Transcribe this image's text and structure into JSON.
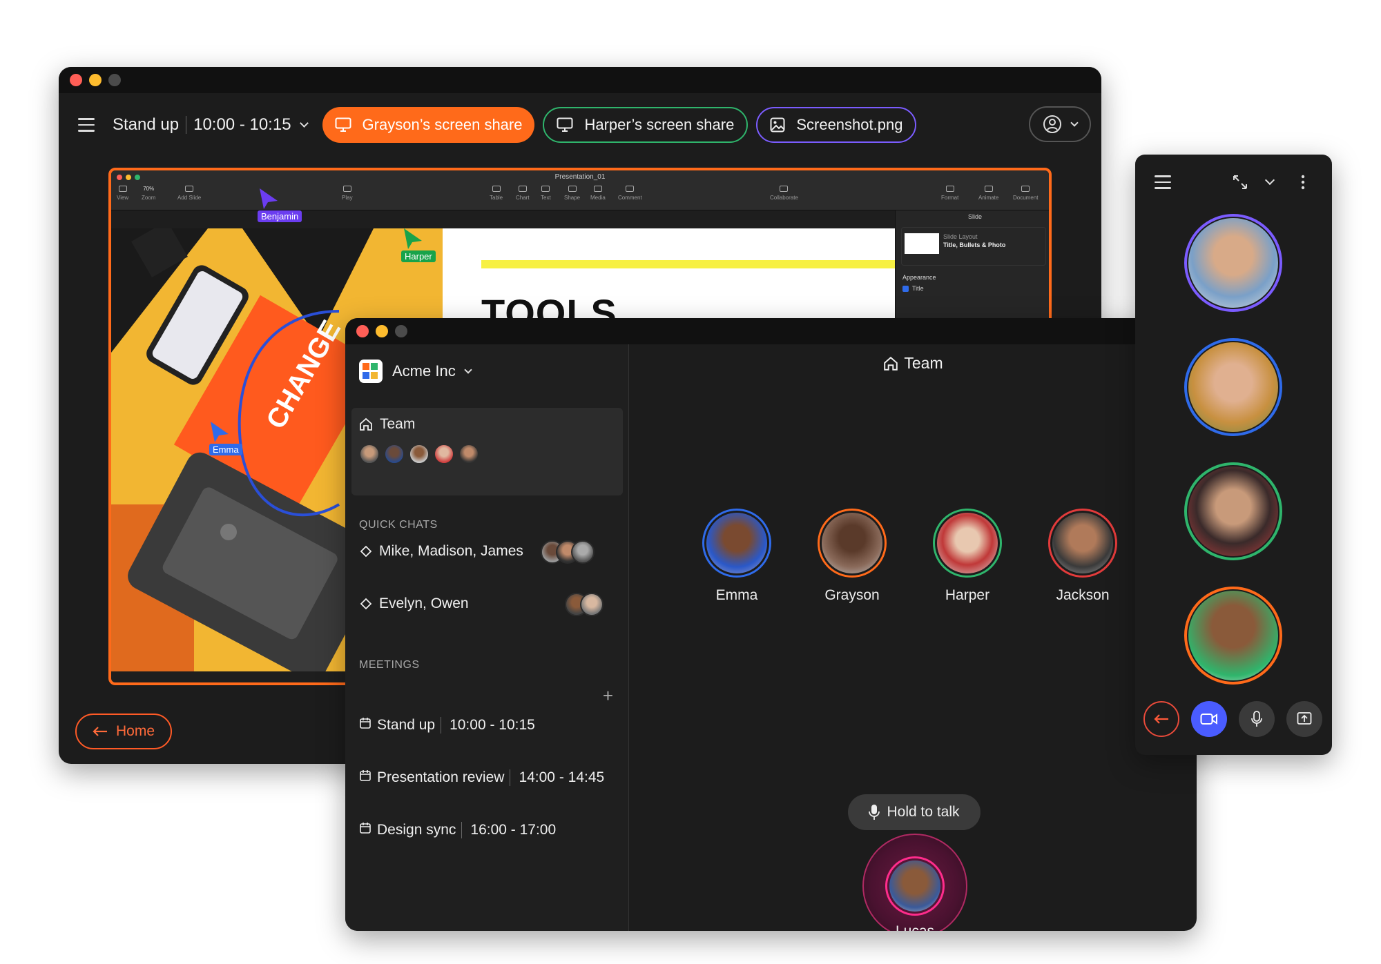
{
  "window1": {
    "meeting_name": "Stand up",
    "meeting_time": "10:00 - 10:15",
    "chips": [
      {
        "label": "Grayson’s screen share",
        "style": "active",
        "color": "#ff6a1a"
      },
      {
        "label": "Harper’s screen share",
        "style": "outline",
        "color": "#2fb56c"
      },
      {
        "label": "Screenshot.png",
        "style": "outline",
        "color": "#7b5cff"
      }
    ],
    "home_label": "Home",
    "shared_app": {
      "doc_title": "Presentation_01",
      "toolbar_left": [
        "View",
        "Zoom",
        "Add Slide",
        "Play"
      ],
      "zoom_value": "70%",
      "toolbar_mid": [
        "Table",
        "Chart",
        "Text",
        "Shape",
        "Media",
        "Comment"
      ],
      "collaborate": "Collaborate",
      "toolbar_right": [
        "Format",
        "Animate",
        "Document"
      ],
      "inspector_tab": "Slide",
      "layout_label": "Slide Layout",
      "layout_value": "Title, Bullets & Photo",
      "appearance_label": "Appearance",
      "title_checkbox": "Title",
      "slide_heading": "TOOLS",
      "cursors": [
        {
          "name": "Benjamin",
          "color": "#6b3df0"
        },
        {
          "name": "Harper",
          "color": "#18a34a"
        },
        {
          "name": "Emma",
          "color": "#2f6bea"
        }
      ]
    }
  },
  "window2": {
    "org_name": "Acme Inc",
    "team_label": "Team",
    "quick_chats_label": "QUICK CHATS",
    "quick_chats": [
      {
        "label": "Mike, Madison, James"
      },
      {
        "label": "Evelyn, Owen"
      }
    ],
    "meetings_label": "MEETINGS",
    "meetings": [
      {
        "name": "Stand up",
        "time": "10:00 - 10:15"
      },
      {
        "name": "Presentation review",
        "time": "14:00 - 14:45"
      },
      {
        "name": "Design sync",
        "time": "16:00 - 17:00"
      }
    ],
    "main_title": "Team",
    "participants": [
      {
        "name": "Emma",
        "ring": "#2f6bea"
      },
      {
        "name": "Grayson",
        "ring": "#ff6a1a"
      },
      {
        "name": "Harper",
        "ring": "#2fb56c"
      },
      {
        "name": "Jackson",
        "ring": "#e23b3b"
      }
    ],
    "hold_to_talk": "Hold to talk",
    "speaker": {
      "name": "Lucas",
      "ring": "#ff2c8c"
    }
  },
  "window3": {
    "video_rings": [
      "#7b5cff",
      "#2f6bea",
      "#2fb56c",
      "#ff6a1a"
    ],
    "controls": [
      "leave-icon",
      "video-icon",
      "mic-icon",
      "share-icon"
    ]
  },
  "colors": {
    "accent_orange": "#ff6a1a",
    "accent_blue": "#4a5cff",
    "bg_dark": "#1c1c1c"
  }
}
